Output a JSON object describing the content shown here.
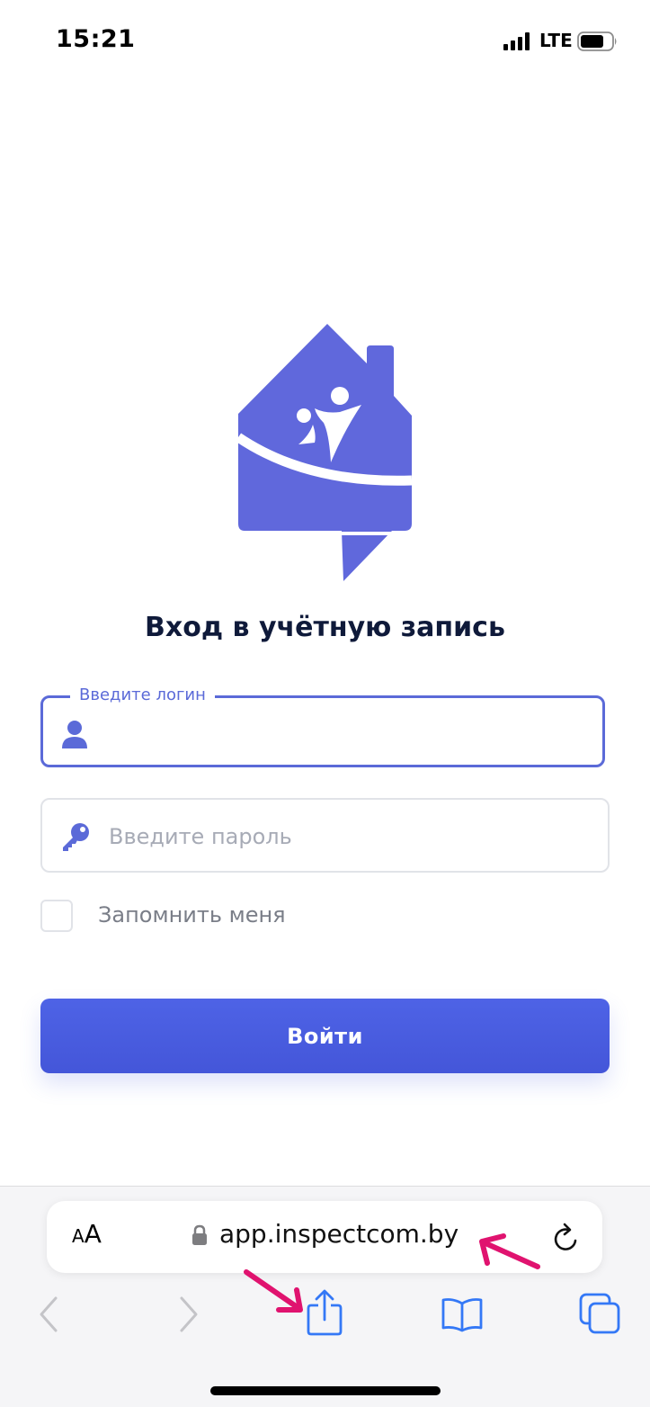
{
  "status_bar": {
    "time": "15:21",
    "network": "LTE",
    "icons": [
      "signal-icon",
      "battery-icon"
    ]
  },
  "logo": {
    "icon": "house-people-logo",
    "color": "#6068dc"
  },
  "form": {
    "title": "Вход в учётную запись",
    "login": {
      "label": "Введите логин",
      "value": "",
      "icon": "user-icon"
    },
    "password": {
      "placeholder": "Введите пароль",
      "value": "",
      "icon": "key-icon"
    },
    "remember": {
      "label": "Запомнить меня",
      "checked": false
    },
    "submit_label": "Войти"
  },
  "browser": {
    "text_size_small": "A",
    "text_size_large": "A",
    "url": "app.inspectcom.by",
    "icons": [
      "lock-icon",
      "reload-icon",
      "back-icon",
      "forward-icon",
      "share-icon",
      "bookmarks-icon",
      "tabs-icon"
    ]
  },
  "colors": {
    "accent": "#5b6ad8",
    "button": "#4a5de3",
    "annotation": "#e0136f",
    "ios_blue": "#3478f6"
  }
}
